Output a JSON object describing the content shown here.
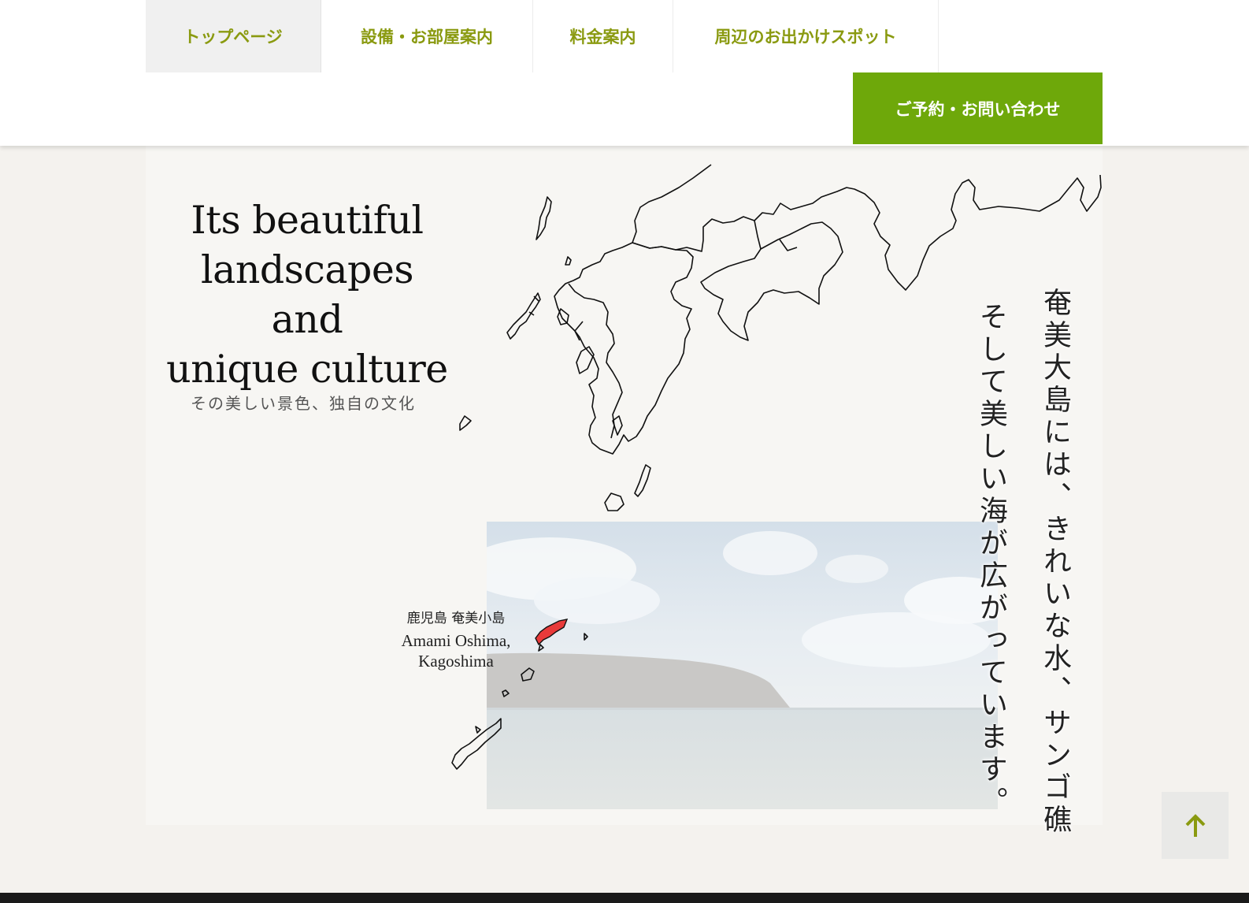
{
  "nav": {
    "items": [
      {
        "label": "トップページ",
        "active": true
      },
      {
        "label": "設備・お部屋案内",
        "active": false
      },
      {
        "label": "料金案内",
        "active": false
      },
      {
        "label": "周辺のお出かけスポット",
        "active": false
      }
    ],
    "cta_label": "ご予約・お問い合わせ"
  },
  "hero": {
    "headline_line1": "Its beautiful",
    "headline_line2": "landscapes and",
    "headline_line3": "unique culture",
    "subline": "その美しい景色、独自の文化",
    "vertical_text_1": "奄美大島には、きれいな水、サンゴ礁",
    "vertical_text_2": "そして美しい海が広がっています。",
    "map_label_jp": "鹿児島  奄美小島",
    "map_label_en_line1": "Amami Oshima,",
    "map_label_en_line2": "Kagoshima"
  },
  "colors": {
    "accent_green": "#6ea80a",
    "nav_text": "#8a9a10",
    "highlight_island": "#e83a3a",
    "background": "#f7f6f3"
  },
  "icons": {
    "back_to_top": "arrow-up-icon"
  }
}
